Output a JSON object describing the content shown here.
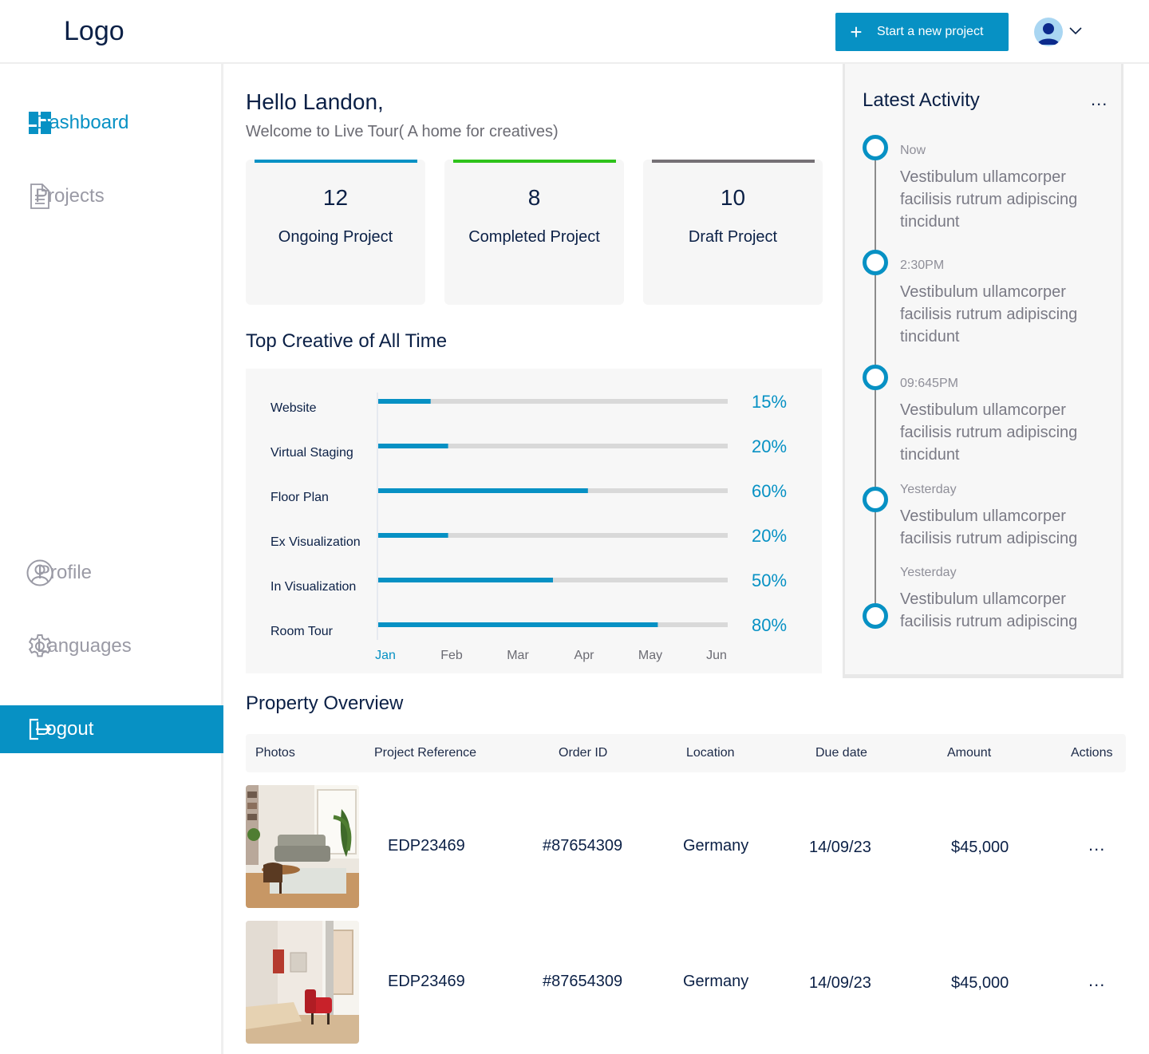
{
  "header": {
    "logo": "Logo",
    "new_project_label": "Start a new project"
  },
  "sidebar": {
    "items": [
      {
        "label": "Dashboard"
      },
      {
        "label": "Projects"
      },
      {
        "label": "Profile"
      },
      {
        "label": "Languages"
      },
      {
        "label": "Logout"
      }
    ]
  },
  "greeting": {
    "title": "Hello Landon,",
    "subtitle": "Welcome to Live Tour( A home for creatives)"
  },
  "stats": [
    {
      "value": "12",
      "label": "Ongoing Project",
      "color": "#0791c4"
    },
    {
      "value": "8",
      "label": "Completed Project",
      "color": "#2ec31b"
    },
    {
      "value": "10",
      "label": "Draft Project",
      "color": "#757075"
    }
  ],
  "chart_section_title": "Top Creative of All Time",
  "chart_data": {
    "type": "bar",
    "orientation": "horizontal",
    "categories": [
      "Website",
      "Virtual Staging",
      "Floor Plan",
      "Ex Visualization",
      "In Visualization",
      "Room Tour"
    ],
    "values": [
      15,
      20,
      60,
      20,
      50,
      80
    ],
    "value_labels": [
      "15%",
      "20%",
      "60%",
      "20%",
      "50%",
      "80%"
    ],
    "x_ticks": [
      "Jan",
      "Feb",
      "Mar",
      "Apr",
      "May",
      "Jun"
    ],
    "active_tick": "Jan",
    "xlim": [
      0,
      100
    ],
    "bar_color": "#0791c4",
    "track_color": "#d9d9d9"
  },
  "activity": {
    "title": "Latest Activity",
    "more": "...",
    "items": [
      {
        "time": "Now",
        "text": "Vestibulum ullamcorper facilisis rutrum adipiscing tincidunt"
      },
      {
        "time": "2:30PM",
        "text": "Vestibulum ullamcorper facilisis rutrum adipiscing tincidunt"
      },
      {
        "time": "09:645PM",
        "text": "Vestibulum ullamcorper facilisis rutrum adipiscing tincidunt"
      },
      {
        "time": "Yesterday",
        "text": "Vestibulum ullamcorper facilisis rutrum adipiscing"
      },
      {
        "time": "Yesterday",
        "text": "Vestibulum ullamcorper facilisis rutrum adipiscing"
      }
    ]
  },
  "overview": {
    "title": "Property Overview",
    "columns": [
      "Photos",
      "Project Reference",
      "Order ID",
      "Location",
      "Due date",
      "Amount",
      "Actions"
    ],
    "rows": [
      {
        "reference": "EDP23469",
        "order_id": "#87654309",
        "location": "Germany",
        "due_date": "14/09/23",
        "amount": "$45,000",
        "action": "..."
      },
      {
        "reference": "EDP23469",
        "order_id": "#87654309",
        "location": "Germany",
        "due_date": "14/09/23",
        "amount": "$45,000",
        "action": "..."
      }
    ]
  }
}
